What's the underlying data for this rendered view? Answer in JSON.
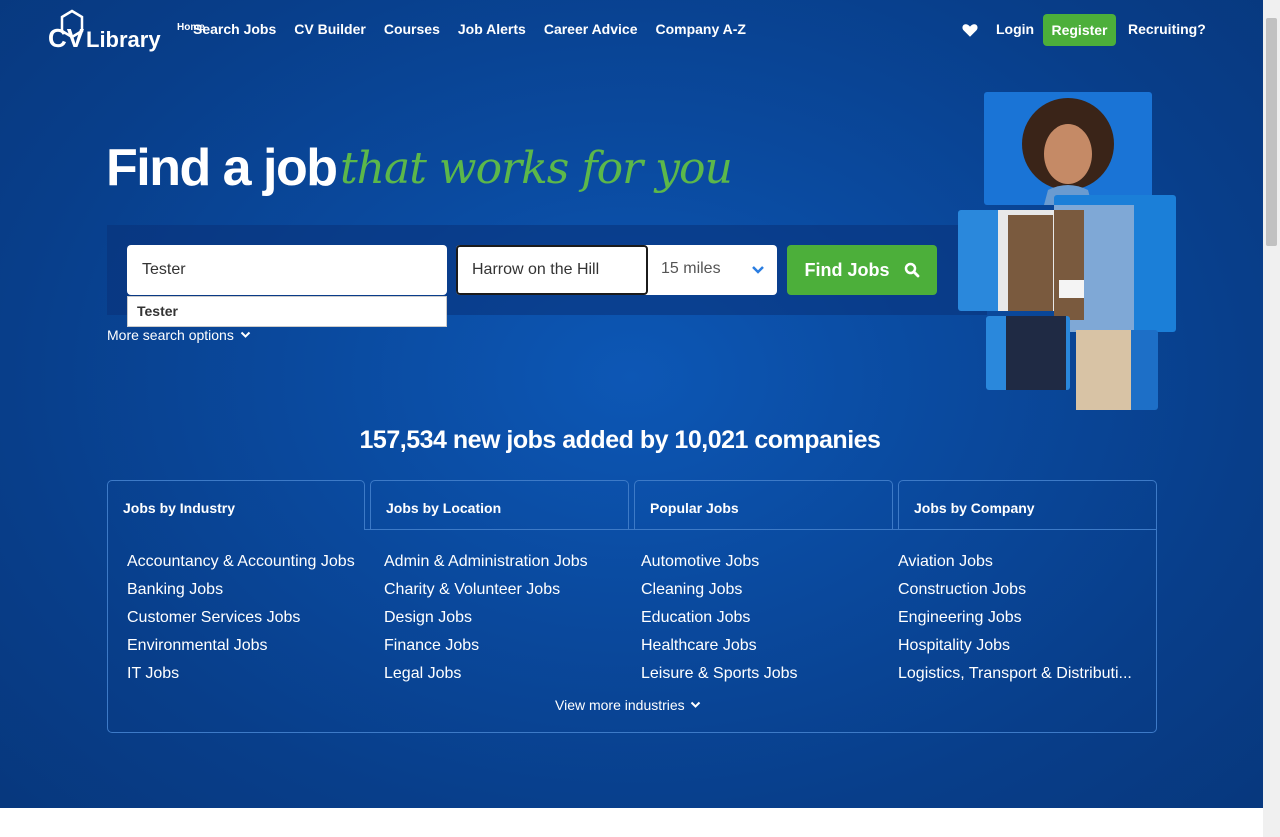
{
  "header": {
    "logo_text": "CV Library",
    "logo_home": "Home",
    "nav": [
      "Search Jobs",
      "CV Builder",
      "Courses",
      "Job Alerts",
      "Career Advice",
      "Company A-Z"
    ],
    "login": "Login",
    "register": "Register",
    "recruiting": "Recruiting?"
  },
  "hero": {
    "title": "Find a job",
    "tagline": "that works for you"
  },
  "search": {
    "keywords_value": "Tester",
    "suggestion": "Tester",
    "location_value": "Harrow on the Hill",
    "distance": "15 miles",
    "find_button": "Find Jobs",
    "more_options": "More search options"
  },
  "stats": "157,534 new jobs added by 10,021 companies",
  "tabs": [
    "Jobs by Industry",
    "Jobs by Location",
    "Popular Jobs",
    "Jobs by Company"
  ],
  "industries": {
    "col1": [
      "Accountancy & Accounting Jobs",
      "Banking Jobs",
      "Customer Services Jobs",
      "Environmental Jobs",
      "IT Jobs"
    ],
    "col2": [
      "Admin & Administration Jobs",
      "Charity & Volunteer Jobs",
      "Design Jobs",
      "Finance Jobs",
      "Legal Jobs"
    ],
    "col3": [
      "Automotive Jobs",
      "Cleaning Jobs",
      "Education Jobs",
      "Healthcare Jobs",
      "Leisure & Sports Jobs"
    ],
    "col4": [
      "Aviation Jobs",
      "Construction Jobs",
      "Engineering Jobs",
      "Hospitality Jobs",
      "Logistics, Transport & Distributi..."
    ]
  },
  "view_more": "View more industries",
  "colors": {
    "brand_green": "#4caf3a",
    "background": "#0a4a9f",
    "tagline": "#5cb84a"
  }
}
